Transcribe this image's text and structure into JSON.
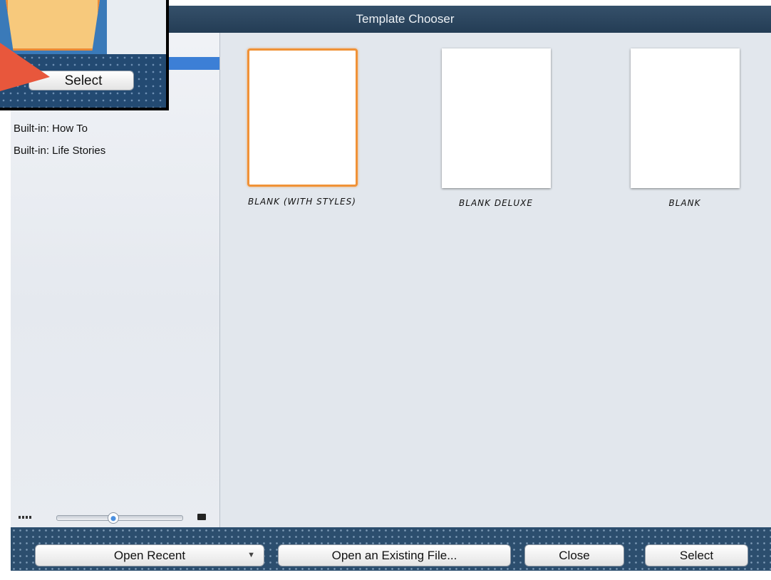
{
  "window": {
    "title": "Template Chooser"
  },
  "sidebar": {
    "items": [
      {
        "label": "Built-in: How To"
      },
      {
        "label": "Built-in: Life Stories"
      }
    ]
  },
  "templates": [
    {
      "label": "BLANK (WITH STYLES)",
      "selected": true
    },
    {
      "label": "BLANK DELUXE",
      "selected": false
    },
    {
      "label": "BLANK",
      "selected": false
    }
  ],
  "footer": {
    "open_recent": "Open Recent",
    "open_existing": "Open an Existing File...",
    "close": "Close",
    "select": "Select"
  },
  "inset": {
    "select_label": "Select"
  },
  "colors": {
    "accent": "#f09237",
    "titlebar": "#2c4660",
    "footer": "#2c4e6e",
    "selection": "#3c7fd6",
    "arrow": "#e8573c"
  }
}
